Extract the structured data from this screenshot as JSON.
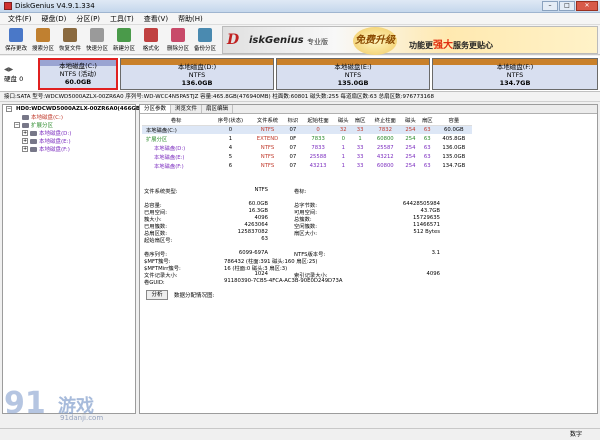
{
  "window": {
    "title": "DiskGenius V4.9.1.334"
  },
  "window_buttons": {
    "min": "–",
    "max": "□",
    "close": "✕"
  },
  "menu": [
    "文件(F)",
    "硬盘(D)",
    "分区(P)",
    "工具(T)",
    "查看(V)",
    "帮助(H)"
  ],
  "toolbar": [
    {
      "label": "保存更改",
      "icon": "save-icon",
      "color": "#4a78c8"
    },
    {
      "label": "搜索分区",
      "icon": "magnifier-icon",
      "color": "#c08030"
    },
    {
      "label": "恢复文件",
      "icon": "recover-icon",
      "color": "#8a6a40"
    },
    {
      "label": "快速分区",
      "icon": "quick-partition-icon",
      "color": "#9a9a9a"
    },
    {
      "label": "新建分区",
      "icon": "new-partition-icon",
      "color": "#4a9a4a"
    },
    {
      "label": "格式化",
      "icon": "format-icon",
      "color": "#c04040"
    },
    {
      "label": "删除分区",
      "icon": "delete-partition-icon",
      "color": "#c84a6a"
    },
    {
      "label": "备份分区",
      "icon": "backup-partition-icon",
      "color": "#4a8ab0"
    }
  ],
  "banner": {
    "logo_dk": "D",
    "logo_rest": "iskGenius",
    "logo_sub": "专业版",
    "seal": "免费升级",
    "slogan_pre": "功能更",
    "slogan_strong": "强大",
    "slogan_post": "服务更贴心"
  },
  "diskbar": {
    "disk_label": "硬盘 0",
    "partitions": [
      {
        "name": "本地磁盘(C:)",
        "fs": "NTFS (活动)",
        "size": "60.0GB",
        "selected": true,
        "color": "#9aa4d2"
      },
      {
        "name": "本地磁盘(D:)",
        "fs": "NTFS",
        "size": "136.0GB",
        "selected": false,
        "color": "#c9802a"
      },
      {
        "name": "本地磁盘(E:)",
        "fs": "NTFS",
        "size": "135.0GB",
        "selected": false,
        "color": "#c9802a"
      },
      {
        "name": "本地磁盘(F:)",
        "fs": "NTFS",
        "size": "134.7GB",
        "selected": false,
        "color": "#c9802a"
      }
    ]
  },
  "infobar": "接口:SATA  型号:WDCWD5000AZLX-00ZR6A0  序列号:WD-WCC4N5PA5TJZ  容量:465.8GB(476940MB)  柱面数:60801  磁头数:255  每道扇区数:63  总扇区数:976773168",
  "tree": [
    {
      "indent": 0,
      "exp": "−",
      "label": "HD0:WDCWD5000AZLX-00ZR6A0(466GB)",
      "color": "#000",
      "bold": true
    },
    {
      "indent": 1,
      "exp": "",
      "label": "本地磁盘(C:)",
      "color": "#c0392b"
    },
    {
      "indent": 1,
      "exp": "−",
      "label": "扩展分区",
      "color": "#2a8a2a"
    },
    {
      "indent": 2,
      "exp": "+",
      "label": "本地磁盘(D:)",
      "color": "#7b2cbf"
    },
    {
      "indent": 2,
      "exp": "+",
      "label": "本地磁盘(E:)",
      "color": "#7b2cbf"
    },
    {
      "indent": 2,
      "exp": "+",
      "label": "本地磁盘(F:)",
      "color": "#7b2cbf"
    }
  ],
  "tabs": [
    "分区参数",
    "浏览文件",
    "扇区编辑"
  ],
  "table": {
    "headers": [
      "卷标",
      "序号(状态)",
      "文件系统",
      "标识",
      "起始柱面",
      "磁头",
      "扇区",
      "终止柱面",
      "磁头",
      "扇区",
      "容量"
    ],
    "rows": [
      {
        "name": "本地磁盘(C:)",
        "cells": [
          "0",
          "NTFS",
          "07",
          "0",
          "32",
          "33",
          "7832",
          "254",
          "63",
          "60.0GB"
        ],
        "color": "#000",
        "selected": true
      },
      {
        "name": "扩展分区",
        "cells": [
          "1",
          "EXTEND",
          "0F",
          "7833",
          "0",
          "1",
          "60800",
          "254",
          "63",
          "405.8GB"
        ],
        "color": "#2a8a2a",
        "selected": false
      },
      {
        "name": "本地磁盘(D:)",
        "cells": [
          "4",
          "NTFS",
          "07",
          "7833",
          "1",
          "33",
          "25587",
          "254",
          "63",
          "136.0GB"
        ],
        "color": "#7b2cbf",
        "selected": false
      },
      {
        "name": "本地磁盘(E:)",
        "cells": [
          "5",
          "NTFS",
          "07",
          "25588",
          "1",
          "33",
          "43212",
          "254",
          "63",
          "135.0GB"
        ],
        "color": "#7b2cbf",
        "selected": false
      },
      {
        "name": "本地磁盘(F:)",
        "cells": [
          "6",
          "NTFS",
          "07",
          "43213",
          "1",
          "33",
          "60800",
          "254",
          "63",
          "134.7GB"
        ],
        "color": "#7b2cbf",
        "selected": false
      }
    ]
  },
  "props": [
    {
      "k1": "文件系统类型:",
      "v1": "NTFS",
      "k2": "卷标:",
      "v2": ""
    },
    {
      "k1": "",
      "v1": "",
      "k2": "",
      "v2": ""
    },
    {
      "k1": "总容量:",
      "v1": "60.0GB",
      "k2": "总字节数:",
      "v2": "64428505984"
    },
    {
      "k1": "已用空间:",
      "v1": "16.3GB",
      "k2": "可用空间:",
      "v2": "43.7GB"
    },
    {
      "k1": "簇大小:",
      "v1": "4096",
      "k2": "总簇数:",
      "v2": "15729635"
    },
    {
      "k1": "已用簇数:",
      "v1": "4263064",
      "k2": "空闲簇数:",
      "v2": "11466571"
    },
    {
      "k1": "总扇区数:",
      "v1": "125837082",
      "k2": "扇区大小:",
      "v2": "512 Bytes"
    },
    {
      "k1": "起始扇区号:",
      "v1": "63",
      "k2": "",
      "v2": ""
    },
    {
      "k1": "",
      "v1": "",
      "k2": "",
      "v2": ""
    },
    {
      "k1": "卷序列号:",
      "v1": "6099-697A",
      "k2": "NTFS版本号:",
      "v2": "3.1"
    },
    {
      "k1": "$MFT簇号:",
      "v1": "786432 (柱面:391 磁头:160 扇区:25)",
      "k2": "",
      "v2": ""
    },
    {
      "k1": "$MFTMirr簇号:",
      "v1": "16 (柱面:0 磁头:3 扇区:3)",
      "k2": "",
      "v2": ""
    },
    {
      "k1": "文件记录大小:",
      "v1": "1024",
      "k2": "索引记录大小:",
      "v2": "4096"
    },
    {
      "k1": "卷GUID:",
      "v1": "91180390-7CB5-4FCA-AC3B-90E0D249D73A",
      "k2": "",
      "v2": ""
    }
  ],
  "analyze_button": "分析",
  "analyze_label": "数据分配情况图:",
  "statusbar": {
    "right": "数字"
  },
  "watermark": {
    "big": "91",
    "cn": "游戏",
    "url": "91danji.com"
  }
}
